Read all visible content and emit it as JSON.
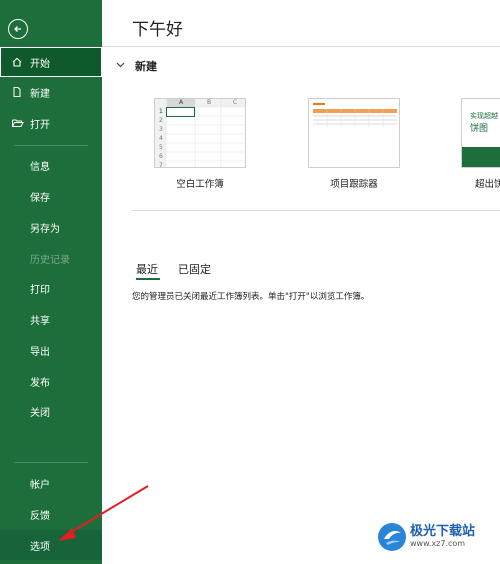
{
  "sidebar": {
    "back_icon": "back-arrow-icon",
    "items": [
      {
        "label": "开始",
        "icon": "home-icon"
      },
      {
        "label": "新建",
        "icon": "new-file-icon"
      },
      {
        "label": "打开",
        "icon": "open-folder-icon"
      },
      {
        "label": "信息"
      },
      {
        "label": "保存"
      },
      {
        "label": "另存为"
      },
      {
        "label": "历史记录"
      },
      {
        "label": "打印"
      },
      {
        "label": "共享"
      },
      {
        "label": "导出"
      },
      {
        "label": "发布"
      },
      {
        "label": "关闭"
      },
      {
        "label": "帐户"
      },
      {
        "label": "反馈"
      },
      {
        "label": "选项"
      }
    ]
  },
  "main": {
    "greeting": "下午好",
    "new_section": {
      "title": "新建",
      "templates": [
        {
          "label": "空白工作簿",
          "col_a": "A",
          "col_b": "B",
          "col_c": "C",
          "rows": [
            "1",
            "2",
            "3",
            "4",
            "5",
            "6",
            "7"
          ]
        },
        {
          "label": "项目跟踪器"
        },
        {
          "label": "超出饼",
          "thumb_text_1": "实现超越",
          "thumb_text_2": "饼图"
        }
      ]
    },
    "tabs": [
      {
        "label": "最近"
      },
      {
        "label": "已固定"
      }
    ],
    "message": "您的管理员已关闭最近工作簿列表。单击\"打开\"以浏览工作簿。"
  },
  "watermark": {
    "name": "极光下载站",
    "url": "www.xz7.com"
  },
  "colors": {
    "sidebar_bg": "#1e6e3c",
    "sidebar_active": "#0f5a2c",
    "accent": "#1e6e3c",
    "annotation_arrow": "#e02020"
  }
}
